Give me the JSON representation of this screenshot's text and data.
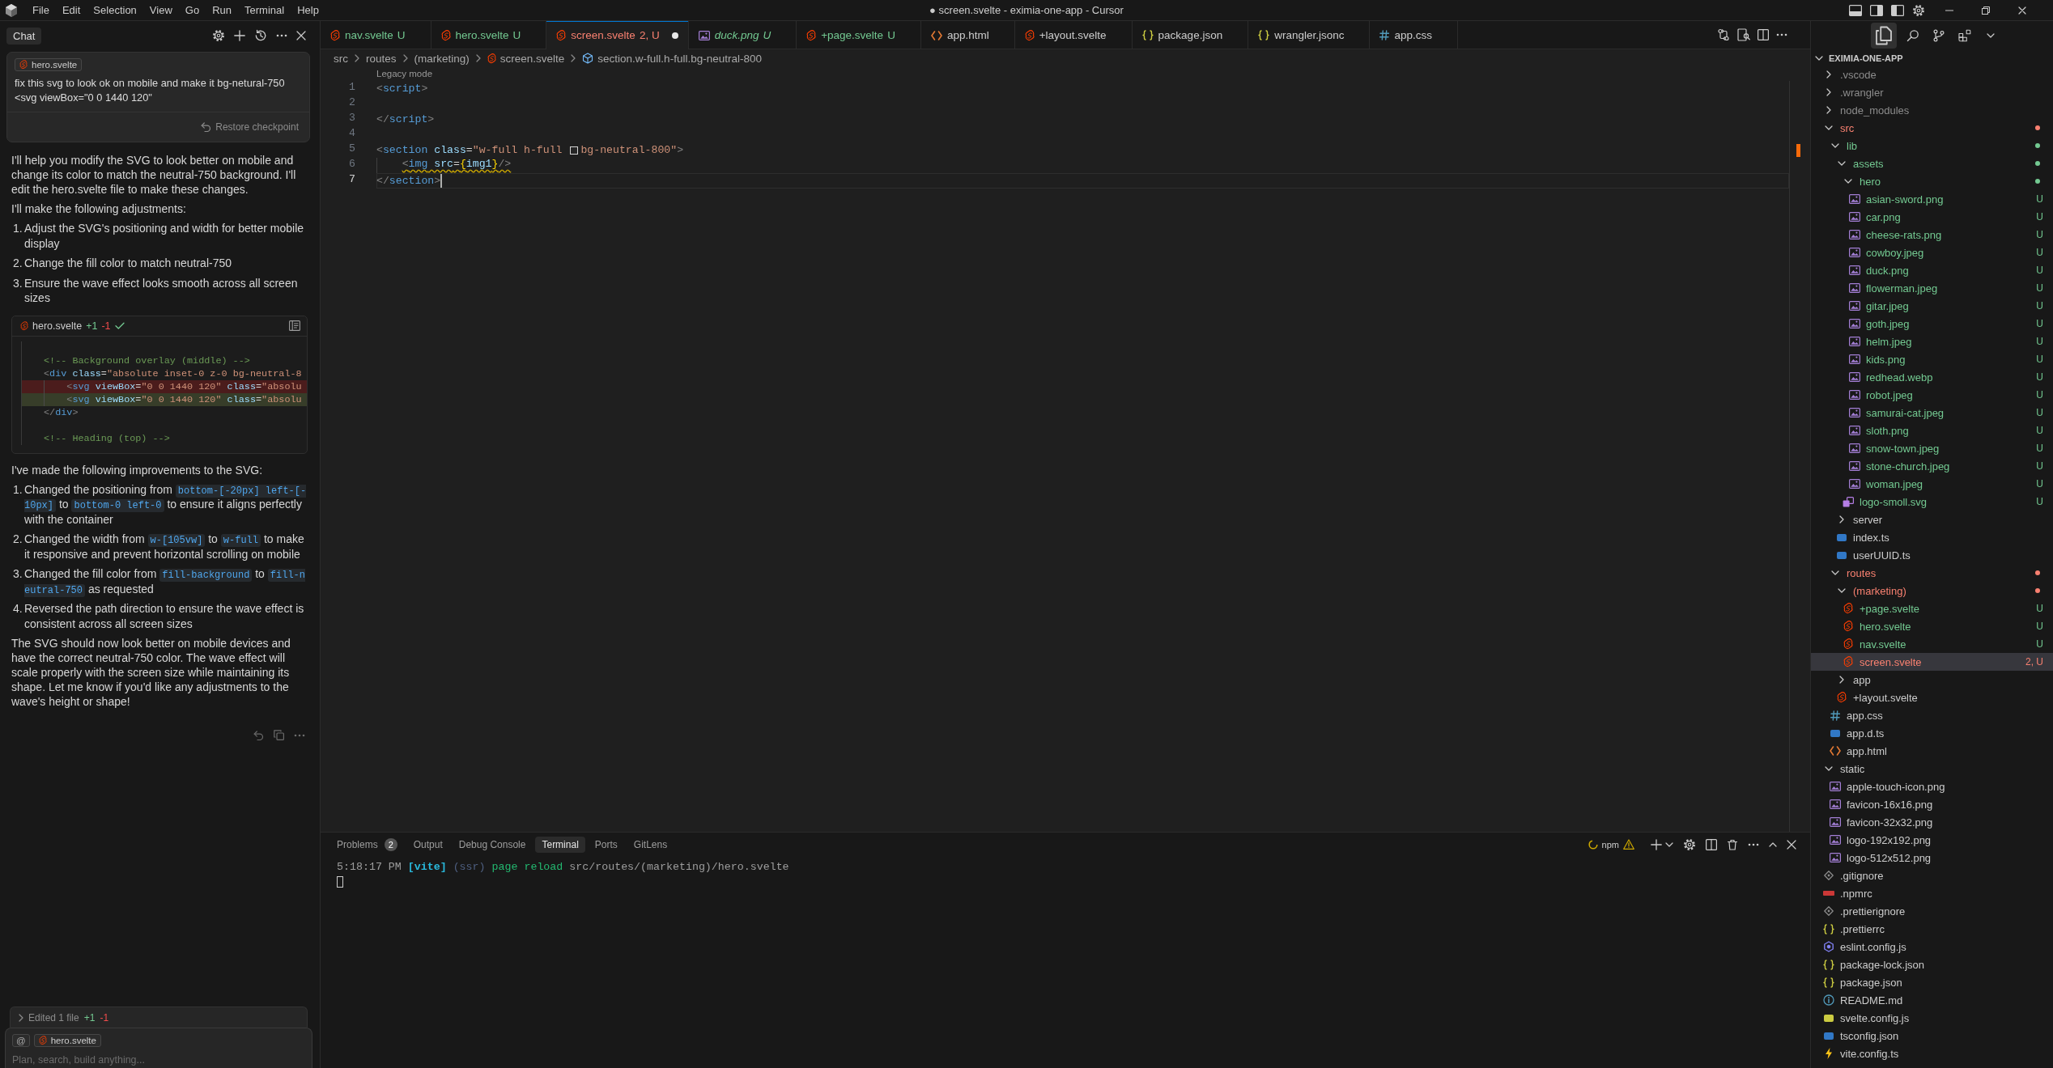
{
  "title_bar": {
    "menu": [
      "File",
      "Edit",
      "Selection",
      "View",
      "Go",
      "Run",
      "Terminal",
      "Help"
    ],
    "title": "● screen.svelte - eximia-one-app - Cursor"
  },
  "chat": {
    "tab": "Chat",
    "user_message": {
      "file_chip": "hero.svelte",
      "lines": [
        "fix this svg to look ok on mobile and make it bg-netural-750",
        "<svg viewBox=\"0 0 1440 120\""
      ],
      "restore": "Restore checkpoint"
    },
    "reply": [
      {
        "kind": "paragraph",
        "text": "I'll help you modify the SVG to look better on mobile and change its color to match the neutral-750 background. I'll edit the hero.svelte file to make these changes."
      },
      {
        "kind": "paragraph",
        "text": "I'll make the following adjustments:"
      },
      {
        "kind": "list",
        "items": [
          {
            "number": "1.",
            "text": "Adjust the SVG's positioning and width for better mobile display"
          },
          {
            "number": "2.",
            "text": "Change the fill color to match neutral-750"
          },
          {
            "number": "3.",
            "text": "Ensure the wave effect looks smooth across all screen sizes"
          }
        ]
      },
      {
        "kind": "code",
        "file": "hero.svelte",
        "added": "+1",
        "removed": "-1",
        "accepted": true,
        "lines": [
          {
            "kind": "context"
          },
          {
            "kind": "context",
            "tokens": [
              {
                "text": "<!-- Background overlay (middle) -->",
                "kind": "comment"
              }
            ]
          },
          {
            "kind": "context",
            "tokens": [
              {
                "text": "<",
                "kind": "punct"
              },
              {
                "text": "div",
                "kind": "tag"
              },
              {
                "text": " class",
                "kind": "attr"
              },
              {
                "text": "=",
                "kind": "plain"
              },
              {
                "text": "\"absolute inset-0 z-0 bg-neutral-8",
                "kind": "string"
              }
            ]
          },
          {
            "kind": "removed",
            "indented": true,
            "tokens": [
              {
                "text": "<",
                "kind": "punct"
              },
              {
                "text": "svg",
                "kind": "tag"
              },
              {
                "text": " viewBox",
                "kind": "attr"
              },
              {
                "text": "=",
                "kind": "plain"
              },
              {
                "text": "\"0 0 1440 120\"",
                "kind": "string"
              },
              {
                "text": " class",
                "kind": "attr"
              },
              {
                "text": "=",
                "kind": "plain"
              },
              {
                "text": "\"absolu",
                "kind": "string"
              }
            ]
          },
          {
            "kind": "added",
            "indented": true,
            "tokens": [
              {
                "text": "<",
                "kind": "punct"
              },
              {
                "text": "svg",
                "kind": "tag"
              },
              {
                "text": " viewBox",
                "kind": "attr"
              },
              {
                "text": "=",
                "kind": "plain"
              },
              {
                "text": "\"0 0 1440 120\"",
                "kind": "string"
              },
              {
                "text": " class",
                "kind": "attr"
              },
              {
                "text": "=",
                "kind": "plain"
              },
              {
                "text": "\"absolu",
                "kind": "string"
              }
            ]
          },
          {
            "kind": "context",
            "tokens": [
              {
                "text": "</",
                "kind": "punct"
              },
              {
                "text": "div",
                "kind": "tag"
              },
              {
                "text": ">",
                "kind": "punct"
              }
            ]
          },
          {
            "kind": "context"
          },
          {
            "kind": "context",
            "tokens": [
              {
                "text": "<!-- Heading (top) -->",
                "kind": "comment"
              }
            ]
          }
        ]
      },
      {
        "kind": "paragraph",
        "text": "I've made the following improvements to the SVG:"
      },
      {
        "kind": "list",
        "items": [
          {
            "number": "1.",
            "parts": [
              {
                "text": "Changed the positioning from ",
                "code": false
              },
              {
                "text": "bottom-[-20px] left-[-10px]",
                "code": true
              },
              {
                "text": " to ",
                "code": false
              },
              {
                "text": "bottom-0 left-0",
                "code": true
              },
              {
                "text": " to ensure it aligns perfectly with the container",
                "code": false
              }
            ]
          },
          {
            "number": "2.",
            "parts": [
              {
                "text": "Changed the width from ",
                "code": false
              },
              {
                "text": "w-[105vw]",
                "code": true
              },
              {
                "text": " to ",
                "code": false
              },
              {
                "text": "w-full",
                "code": true
              },
              {
                "text": " to make it responsive and prevent horizontal scrolling on mobile",
                "code": false
              }
            ]
          },
          {
            "number": "3.",
            "parts": [
              {
                "text": "Changed the fill color from ",
                "code": false
              },
              {
                "text": "fill-background",
                "code": true
              },
              {
                "text": " to ",
                "code": false
              },
              {
                "text": "fill-neutral-750",
                "code": true
              },
              {
                "text": " as requested",
                "code": false
              }
            ]
          },
          {
            "number": "4.",
            "parts": [
              {
                "text": "Reversed the path direction to ensure the wave effect is consistent across all screen sizes",
                "code": false
              }
            ]
          }
        ]
      },
      {
        "kind": "paragraph",
        "text": "The SVG should now look better on mobile devices and have the correct neutral-750 color. The wave effect will scale properly with the screen size while maintaining its shape. Let me know if you'd like any adjustments to the wave's height or shape!"
      }
    ],
    "edited": {
      "label": "Edited 1 file",
      "added": "+1",
      "removed": "-1"
    },
    "composer": {
      "mention": "@",
      "file_chip": "hero.svelte",
      "placeholder": "Plan, search, build anything..."
    }
  },
  "editor": {
    "tabs": [
      {
        "label": "nav.svelte",
        "badge": "U",
        "kind": "svelte",
        "color": "#73c991",
        "selected": false,
        "modified": false,
        "preview": false
      },
      {
        "label": "hero.svelte",
        "badge": "U",
        "kind": "svelte",
        "color": "#73c991",
        "selected": false,
        "modified": false,
        "preview": false
      },
      {
        "label": "screen.svelte",
        "badge": "2, U",
        "kind": "svelte",
        "color": "#f88070",
        "selected": true,
        "modified": true,
        "preview": false
      },
      {
        "label": "duck.png",
        "badge": "U",
        "kind": "image",
        "color": "#73c991",
        "selected": false,
        "modified": false,
        "preview": true
      },
      {
        "label": "+page.svelte",
        "badge": "U",
        "kind": "svelte",
        "color": "#73c991",
        "selected": false,
        "modified": false,
        "preview": false
      },
      {
        "label": "app.html",
        "kind": "html",
        "color": "#cccccc",
        "selected": false,
        "modified": false,
        "preview": false
      },
      {
        "label": "+layout.svelte",
        "kind": "svelte",
        "color": "#cccccc",
        "selected": false,
        "modified": false,
        "preview": false
      },
      {
        "label": "package.json",
        "kind": "json",
        "color": "#cccccc",
        "selected": false,
        "modified": false,
        "preview": false
      },
      {
        "label": "wrangler.jsonc",
        "kind": "json",
        "color": "#cccccc",
        "selected": false,
        "modified": false,
        "preview": false
      },
      {
        "label": "app.css",
        "kind": "css",
        "color": "#cccccc",
        "selected": false,
        "modified": false,
        "preview": false
      }
    ],
    "breadcrumb": [
      {
        "text": "src",
        "kind": "folder"
      },
      {
        "text": "routes",
        "kind": "folder"
      },
      {
        "text": "(marketing)",
        "kind": "folder"
      },
      {
        "text": "screen.svelte",
        "kind": "svelte"
      },
      {
        "text": "section.w-full.h-full.bg-neutral-800",
        "kind": "element"
      }
    ],
    "codelens": "Legacy mode",
    "lines": [
      {
        "number": "1",
        "current": false,
        "tokens": [
          {
            "text": "<",
            "kind": "punct"
          },
          {
            "text": "script",
            "kind": "tag"
          },
          {
            "text": ">",
            "kind": "punct"
          }
        ]
      },
      {
        "number": "2",
        "current": false
      },
      {
        "number": "3",
        "current": false,
        "tokens": [
          {
            "text": "</",
            "kind": "punct"
          },
          {
            "text": "script",
            "kind": "tag"
          },
          {
            "text": ">",
            "kind": "punct"
          }
        ]
      },
      {
        "number": "4",
        "current": false
      },
      {
        "number": "5",
        "current": false,
        "tokens": [
          {
            "text": "<",
            "kind": "punct"
          },
          {
            "text": "section",
            "kind": "tag"
          },
          {
            "text": " class",
            "kind": "attr"
          },
          {
            "text": "=",
            "kind": "plain"
          },
          {
            "text": "\"w-full h-full ",
            "kind": "string"
          },
          {
            "text": "bg-neutral-800\"",
            "kind": "color-string"
          },
          {
            "text": ">",
            "kind": "punct"
          }
        ]
      },
      {
        "number": "6",
        "current": false,
        "warning": true,
        "indented": true,
        "tokens": [
          {
            "text": "<",
            "kind": "punct"
          },
          {
            "text": "img",
            "kind": "tag"
          },
          {
            "text": " src",
            "kind": "attr"
          },
          {
            "text": "=",
            "kind": "plain"
          },
          {
            "text": "{",
            "kind": "brace"
          },
          {
            "text": "img1",
            "kind": "var"
          },
          {
            "text": "}",
            "kind": "brace"
          },
          {
            "text": "/>",
            "kind": "punct"
          }
        ]
      },
      {
        "number": "7",
        "current": true,
        "tokens": [
          {
            "text": "</",
            "kind": "punct"
          },
          {
            "text": "section",
            "kind": "tag"
          },
          {
            "text": ">",
            "kind": "punct"
          }
        ]
      }
    ]
  },
  "panel": {
    "tabs": [
      {
        "label": "Problems",
        "count": "2",
        "selected": false
      },
      {
        "label": "Output",
        "selected": false
      },
      {
        "label": "Debug Console",
        "selected": false
      },
      {
        "label": "Terminal",
        "selected": true
      },
      {
        "label": "Ports",
        "selected": false
      },
      {
        "label": "GitLens",
        "selected": false
      }
    ],
    "task": {
      "label": "npm",
      "warning": true
    },
    "terminal": [
      {
        "text": "5:18:17 PM ",
        "kind": "time"
      },
      {
        "text": "[vite] ",
        "kind": "tag"
      },
      {
        "text": "(ssr) ",
        "kind": "dim"
      },
      {
        "text": "page reload ",
        "kind": "action"
      },
      {
        "text": "src/routes/(marketing)/hero.svelte",
        "kind": "path"
      }
    ]
  },
  "explorer": {
    "views": [
      {
        "kind": "files",
        "selected": true
      },
      {
        "kind": "search",
        "selected": false
      },
      {
        "kind": "source-control",
        "selected": false
      },
      {
        "kind": "extensions",
        "selected": false
      }
    ],
    "title": "EXIMIA-ONE-APP",
    "expanded": true,
    "tree": [
      {
        "name": ".vscode",
        "kind": "folder",
        "expanded": false,
        "has_changes": false,
        "color": "#8c8c8c",
        "selected": false
      },
      {
        "name": ".wrangler",
        "kind": "folder",
        "expanded": false,
        "has_changes": false,
        "color": "#8c8c8c",
        "selected": false
      },
      {
        "name": "node_modules",
        "kind": "folder",
        "expanded": false,
        "has_changes": false,
        "color": "#8c8c8c",
        "selected": false
      },
      {
        "name": "src",
        "kind": "folder",
        "expanded": true,
        "has_changes": true,
        "color": "#f88070",
        "selected": false,
        "children": [
          {
            "name": "lib",
            "kind": "folder",
            "expanded": true,
            "has_changes": true,
            "color": "#73c991",
            "selected": false,
            "children": [
              {
                "name": "assets",
                "kind": "folder",
                "expanded": true,
                "has_changes": true,
                "color": "#73c991",
                "selected": false,
                "children": [
                  {
                    "name": "hero",
                    "kind": "folder",
                    "expanded": true,
                    "has_changes": true,
                    "color": "#73c991",
                    "selected": false,
                    "children": [
                      {
                        "name": "asian-sword.png",
                        "kind": "image",
                        "color": "#73c991",
                        "badge": "U",
                        "selected": false
                      },
                      {
                        "name": "car.png",
                        "kind": "image",
                        "color": "#73c991",
                        "badge": "U",
                        "selected": false
                      },
                      {
                        "name": "cheese-rats.png",
                        "kind": "image",
                        "color": "#73c991",
                        "badge": "U",
                        "selected": false
                      },
                      {
                        "name": "cowboy.jpeg",
                        "kind": "image",
                        "color": "#73c991",
                        "badge": "U",
                        "selected": false
                      },
                      {
                        "name": "duck.png",
                        "kind": "image",
                        "color": "#73c991",
                        "badge": "U",
                        "selected": false
                      },
                      {
                        "name": "flowerman.jpeg",
                        "kind": "image",
                        "color": "#73c991",
                        "badge": "U",
                        "selected": false
                      },
                      {
                        "name": "gitar.jpeg",
                        "kind": "image",
                        "color": "#73c991",
                        "badge": "U",
                        "selected": false
                      },
                      {
                        "name": "goth.jpeg",
                        "kind": "image",
                        "color": "#73c991",
                        "badge": "U",
                        "selected": false
                      },
                      {
                        "name": "helm.jpeg",
                        "kind": "image",
                        "color": "#73c991",
                        "badge": "U",
                        "selected": false
                      },
                      {
                        "name": "kids.png",
                        "kind": "image",
                        "color": "#73c991",
                        "badge": "U",
                        "selected": false
                      },
                      {
                        "name": "redhead.webp",
                        "kind": "image",
                        "color": "#73c991",
                        "badge": "U",
                        "selected": false
                      },
                      {
                        "name": "robot.jpeg",
                        "kind": "image",
                        "color": "#73c991",
                        "badge": "U",
                        "selected": false
                      },
                      {
                        "name": "samurai-cat.jpeg",
                        "kind": "image",
                        "color": "#73c991",
                        "badge": "U",
                        "selected": false
                      },
                      {
                        "name": "sloth.png",
                        "kind": "image",
                        "color": "#73c991",
                        "badge": "U",
                        "selected": false
                      },
                      {
                        "name": "snow-town.jpeg",
                        "kind": "image",
                        "color": "#73c991",
                        "badge": "U",
                        "selected": false
                      },
                      {
                        "name": "stone-church.jpeg",
                        "kind": "image",
                        "color": "#73c991",
                        "badge": "U",
                        "selected": false
                      },
                      {
                        "name": "woman.jpeg",
                        "kind": "image",
                        "color": "#73c991",
                        "badge": "U",
                        "selected": false
                      }
                    ]
                  },
                  {
                    "name": "logo-smoll.svg",
                    "kind": "vector",
                    "color": "#73c991",
                    "badge": "U",
                    "selected": false
                  }
                ]
              },
              {
                "name": "server",
                "kind": "folder",
                "expanded": false,
                "has_changes": false,
                "color": "#cccccc",
                "selected": false
              },
              {
                "name": "index.ts",
                "kind": "ts",
                "color": "#cccccc",
                "selected": false
              },
              {
                "name": "userUUID.ts",
                "kind": "ts",
                "color": "#cccccc",
                "selected": false
              }
            ]
          },
          {
            "name": "routes",
            "kind": "folder",
            "expanded": true,
            "has_changes": true,
            "color": "#f88070",
            "selected": false,
            "children": [
              {
                "name": "(marketing)",
                "kind": "folder",
                "expanded": true,
                "has_changes": true,
                "color": "#f88070",
                "selected": false,
                "children": [
                  {
                    "name": "+page.svelte",
                    "kind": "svelte",
                    "color": "#73c991",
                    "badge": "U",
                    "selected": false
                  },
                  {
                    "name": "hero.svelte",
                    "kind": "svelte",
                    "color": "#73c991",
                    "badge": "U",
                    "selected": false
                  },
                  {
                    "name": "nav.svelte",
                    "kind": "svelte",
                    "color": "#73c991",
                    "badge": "U",
                    "selected": false
                  },
                  {
                    "name": "screen.svelte",
                    "kind": "svelte",
                    "color": "#f88070",
                    "badge": "2, U",
                    "selected": true
                  }
                ]
              },
              {
                "name": "app",
                "kind": "folder",
                "expanded": false,
                "has_changes": false,
                "color": "#cccccc",
                "selected": false
              },
              {
                "name": "+layout.svelte",
                "kind": "svelte",
                "color": "#cccccc",
                "selected": false
              }
            ]
          },
          {
            "name": "app.css",
            "kind": "css",
            "color": "#cccccc",
            "selected": false
          },
          {
            "name": "app.d.ts",
            "kind": "ts",
            "color": "#cccccc",
            "selected": false
          },
          {
            "name": "app.html",
            "kind": "html",
            "color": "#cccccc",
            "selected": false
          }
        ]
      },
      {
        "name": "static",
        "kind": "folder",
        "expanded": true,
        "has_changes": false,
        "color": "#cccccc",
        "selected": false,
        "children": [
          {
            "name": "apple-touch-icon.png",
            "kind": "image",
            "color": "#cccccc",
            "selected": false
          },
          {
            "name": "favicon-16x16.png",
            "kind": "image",
            "color": "#cccccc",
            "selected": false
          },
          {
            "name": "favicon-32x32.png",
            "kind": "image",
            "color": "#cccccc",
            "selected": false
          },
          {
            "name": "logo-192x192.png",
            "kind": "image",
            "color": "#cccccc",
            "selected": false
          },
          {
            "name": "logo-512x512.png",
            "kind": "image",
            "color": "#cccccc",
            "selected": false
          }
        ]
      },
      {
        "name": ".gitignore",
        "kind": "ignore",
        "color": "#cccccc",
        "selected": false
      },
      {
        "name": ".npmrc",
        "kind": "npm",
        "color": "#cccccc",
        "selected": false
      },
      {
        "name": ".prettierignore",
        "kind": "ignore",
        "color": "#cccccc",
        "selected": false
      },
      {
        "name": ".prettierrc",
        "kind": "json",
        "color": "#cccccc",
        "selected": false
      },
      {
        "name": "eslint.config.js",
        "kind": "eslint",
        "color": "#cccccc",
        "selected": false
      },
      {
        "name": "package-lock.json",
        "kind": "json",
        "color": "#cccccc",
        "selected": false
      },
      {
        "name": "package.json",
        "kind": "json",
        "color": "#cccccc",
        "selected": false
      },
      {
        "name": "README.md",
        "kind": "info",
        "color": "#cccccc",
        "selected": false
      },
      {
        "name": "svelte.config.js",
        "kind": "js",
        "color": "#cccccc",
        "selected": false
      },
      {
        "name": "tsconfig.json",
        "kind": "tsconfig",
        "color": "#cccccc",
        "selected": false
      },
      {
        "name": "vite.config.ts",
        "kind": "vite",
        "color": "#cccccc",
        "selected": false
      }
    ]
  }
}
